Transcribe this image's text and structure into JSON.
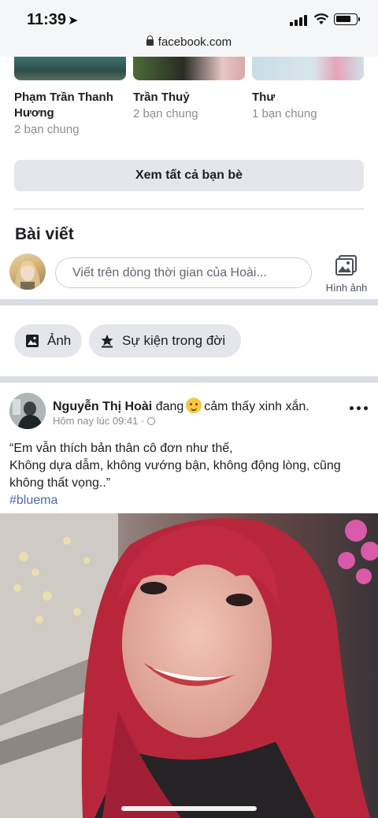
{
  "status_bar": {
    "time": "11:39",
    "url": "facebook.com"
  },
  "friends": [
    {
      "name": "Phạm Trần Thanh Hương",
      "mutual": "2 bạn chung"
    },
    {
      "name": "Trần Thuỷ",
      "mutual": "2 bạn chung"
    },
    {
      "name": "Thư",
      "mutual": "1 bạn chung"
    }
  ],
  "see_all_label": "Xem tất cả bạn bè",
  "posts_section": {
    "title": "Bài viết",
    "composer_placeholder": "Viết trên dòng thời gian của Hoài...",
    "photo_label": "Hình ảnh"
  },
  "chips": {
    "photo": "Ảnh",
    "life_event": "Sự kiện trong đời"
  },
  "post": {
    "author": "Nguyễn Thị Hoài",
    "feeling_prefix": "đang",
    "feeling": "cảm thấy xinh xắn.",
    "time": "Hôm nay lúc 09:41 ·",
    "lines": [
      "“Em vẫn thích bản thân cô đơn như thế,",
      "Không dựa dẫm, không vướng bận, không động lòng, cũng không thất vọng..”"
    ],
    "hashtag": "#bluema"
  },
  "colors": {
    "link": "#4a6ea8",
    "button_bg": "#e4e6eb",
    "separator": "#dadde1"
  }
}
